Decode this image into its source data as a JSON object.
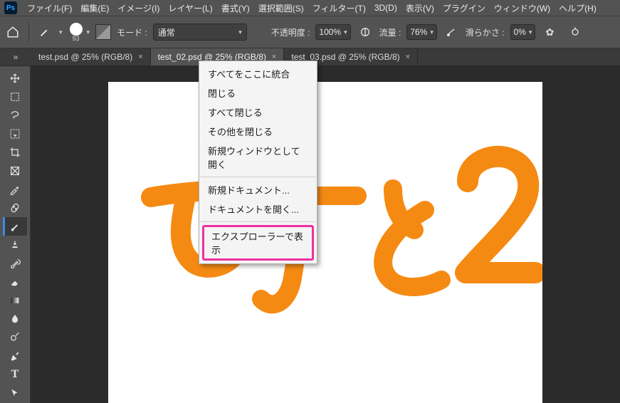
{
  "menu": {
    "items": [
      "ファイル(F)",
      "編集(E)",
      "イメージ(I)",
      "レイヤー(L)",
      "書式(Y)",
      "選択範囲(S)",
      "フィルター(T)",
      "3D(D)",
      "表示(V)",
      "プラグイン",
      "ウィンドウ(W)",
      "ヘルプ(H)"
    ]
  },
  "options": {
    "brush_size": "93",
    "mode_label": "モード :",
    "mode_value": "通常",
    "opacity_label": "不透明度 :",
    "opacity_value": "100%",
    "flow_label": "流量 :",
    "flow_value": "76%",
    "smoothing_label": "滑らかさ :",
    "smoothing_value": "0%"
  },
  "tabs": [
    {
      "label": "test.psd @ 25% (RGB/8)",
      "active": false
    },
    {
      "label": "test_02.psd @ 25% (RGB/8)",
      "active": true
    },
    {
      "label": "test_03.psd @ 25% (RGB/8)",
      "active": false
    }
  ],
  "context_menu": {
    "group1": [
      "すべてをここに統合",
      "閉じる",
      "すべて閉じる",
      "その他を閉じる",
      "新規ウィンドウとして開く"
    ],
    "group2": [
      "新規ドキュメント...",
      "ドキュメントを開く..."
    ],
    "highlight": "エクスプローラーで表示"
  },
  "colors": {
    "brush_stroke": "#f58a13"
  }
}
